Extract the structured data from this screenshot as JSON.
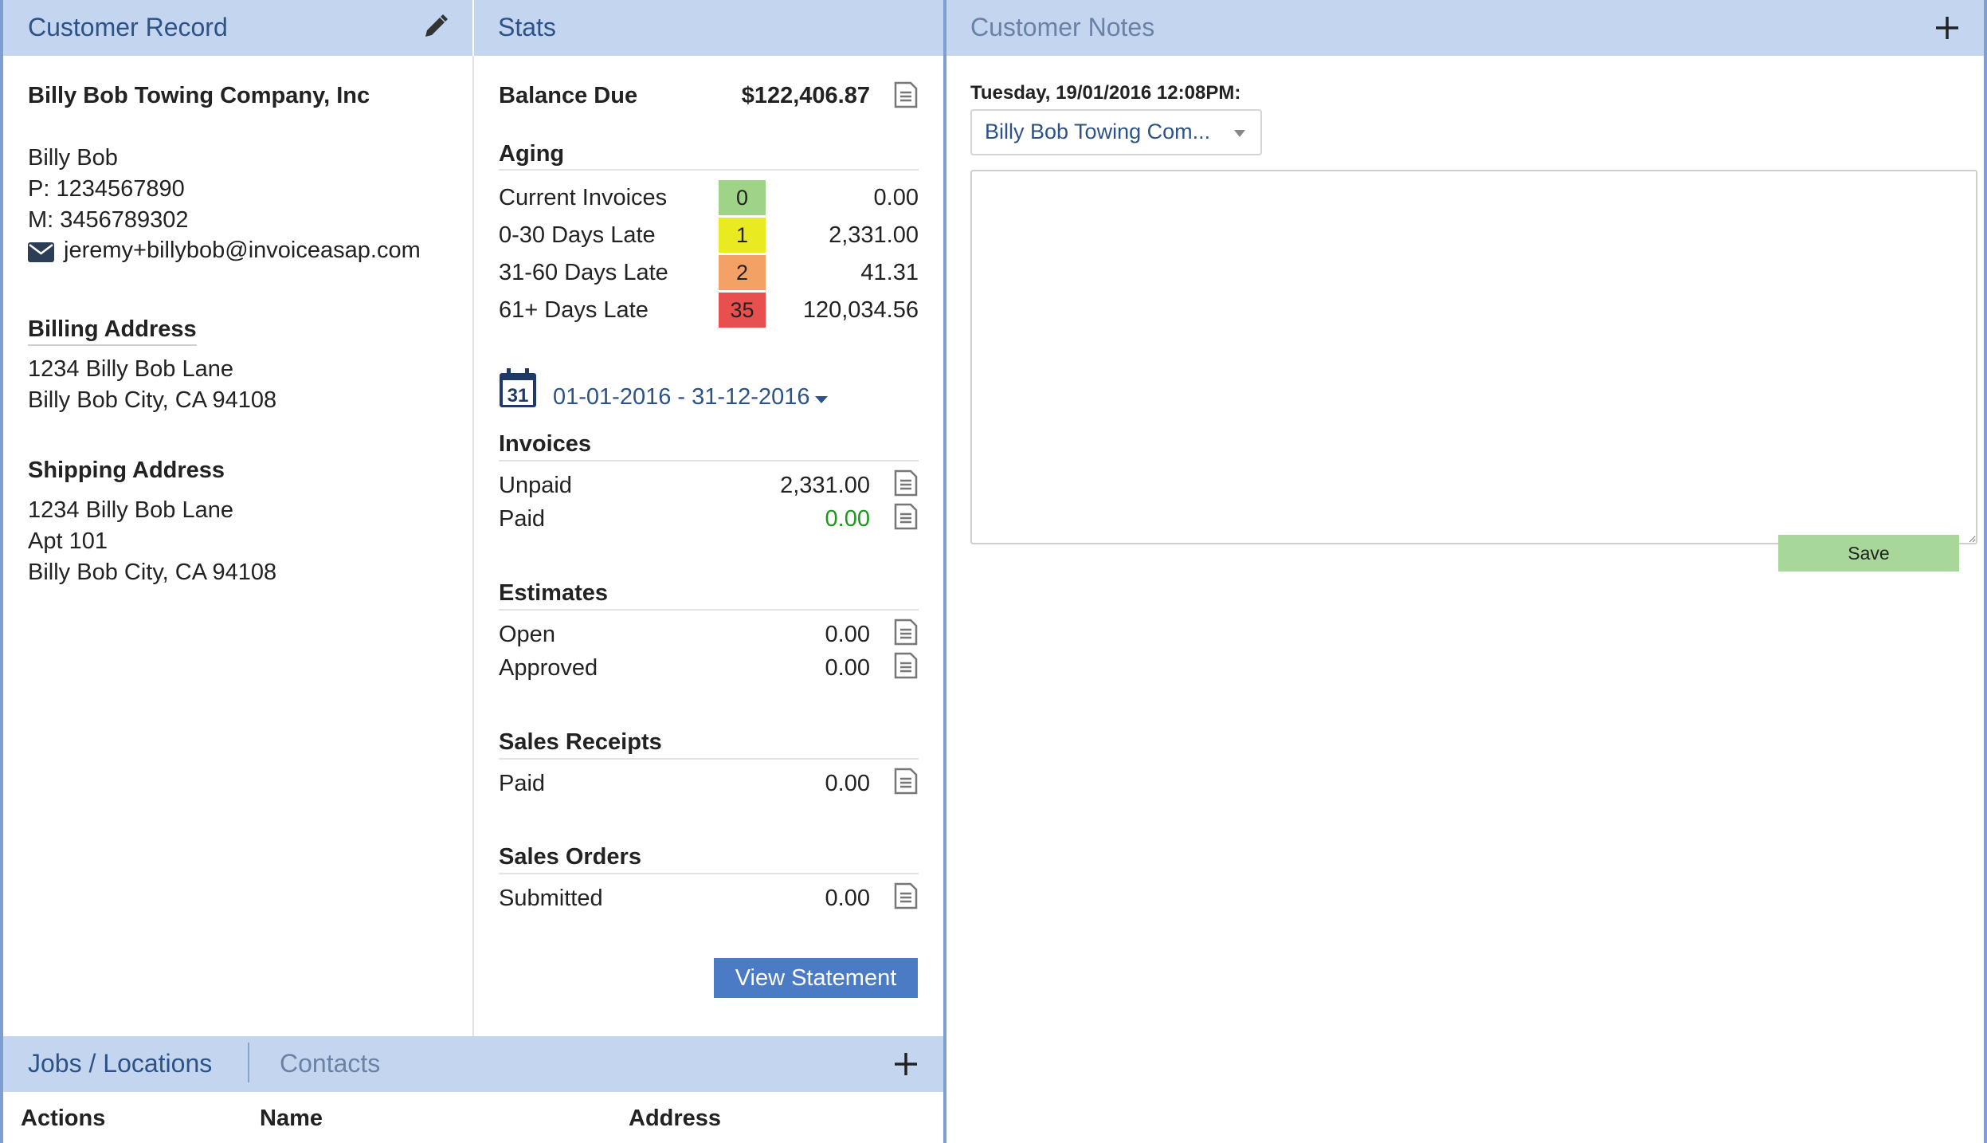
{
  "colors": {
    "header_bg": "#c4d6ef",
    "header_text": "#2c5288",
    "border_blue": "#7f9fd1",
    "aging_current": "#9fd387",
    "aging_0_30": "#eaea20",
    "aging_31_60": "#f3a165",
    "aging_61_plus": "#e85050",
    "paid_green": "#1a9a1a",
    "view_statement_bg": "#4b7bc5",
    "save_bg": "#a8d79a"
  },
  "customer_record": {
    "title": "Customer Record",
    "company": "Billy Bob Towing Company, Inc",
    "contact_name": "Billy Bob",
    "phone": "P: 1234567890",
    "mobile": "M: 3456789302",
    "email": "jeremy+billybob@invoiceasap.com",
    "billing_title": "Billing Address",
    "billing_line1": "1234 Billy Bob Lane",
    "billing_line2": "Billy Bob City, CA 94108",
    "shipping_title": "Shipping Address",
    "shipping_line1": "1234 Billy Bob Lane",
    "shipping_line2": "Apt 101",
    "shipping_line3": "Billy Bob City, CA 94108"
  },
  "stats": {
    "title": "Stats",
    "balance_label": "Balance Due",
    "balance_value": "$122,406.87",
    "aging_title": "Aging",
    "aging": [
      {
        "label": "Current Invoices",
        "count": "0",
        "amount": "0.00"
      },
      {
        "label": "0-30 Days Late",
        "count": "1",
        "amount": "2,331.00"
      },
      {
        "label": "31-60 Days Late",
        "count": "2",
        "amount": "41.31"
      },
      {
        "label": "61+ Days Late",
        "count": "35",
        "amount": "120,034.56"
      }
    ],
    "calendar_day": "31",
    "date_range": "01-01-2016 - 31-12-2016",
    "invoices_title": "Invoices",
    "invoices": [
      {
        "label": "Unpaid",
        "amount": "2,331.00"
      },
      {
        "label": "Paid",
        "amount": "0.00"
      }
    ],
    "estimates_title": "Estimates",
    "estimates": [
      {
        "label": "Open",
        "amount": "0.00"
      },
      {
        "label": "Approved",
        "amount": "0.00"
      }
    ],
    "sales_receipts_title": "Sales Receipts",
    "sales_receipts": [
      {
        "label": "Paid",
        "amount": "0.00"
      }
    ],
    "sales_orders_title": "Sales Orders",
    "sales_orders": [
      {
        "label": "Submitted",
        "amount": "0.00"
      }
    ],
    "view_statement_label": "View Statement"
  },
  "bottom_tabs": {
    "tab1": "Jobs / Locations",
    "tab2": "Contacts",
    "columns": [
      "Actions",
      "Name",
      "Address"
    ]
  },
  "notes": {
    "title": "Customer Notes",
    "timestamp": "Tuesday, 19/01/2016 12:08PM:",
    "selected_customer": "Billy Bob Towing Com...",
    "textarea_value": "",
    "save_label": "Save"
  },
  "icons": {
    "edit": "pencil-icon",
    "email": "envelope-icon",
    "document": "document-icon",
    "calendar": "calendar-icon",
    "dropdown": "caret-down-icon",
    "add": "plus-icon"
  }
}
